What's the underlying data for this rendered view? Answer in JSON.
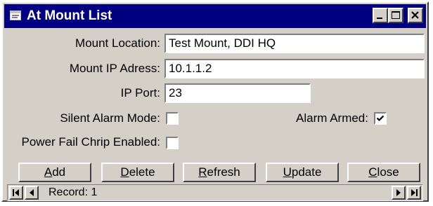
{
  "window": {
    "title": "At Mount List",
    "minimize_glyph": "_",
    "maximize_glyph": "□",
    "close_glyph": "×"
  },
  "form": {
    "mount_location": {
      "label": "Mount Location:",
      "value": "Test Mount, DDI HQ"
    },
    "mount_ip": {
      "label": "Mount IP Adress:",
      "value": "10.1.1.2"
    },
    "ip_port": {
      "label": "IP Port:",
      "value": "23"
    },
    "silent_alarm": {
      "label": "Silent Alarm Mode:",
      "checked": false
    },
    "alarm_armed": {
      "label": "Alarm Armed:",
      "checked": true
    },
    "power_fail_chirp": {
      "label": "Power Fail Chrip Enabled:",
      "checked": false
    }
  },
  "buttons": {
    "add": {
      "accel": "A",
      "rest": "dd"
    },
    "delete": {
      "accel": "D",
      "rest": "elete"
    },
    "refresh": {
      "accel": "R",
      "rest": "efresh"
    },
    "update": {
      "accel": "U",
      "rest": "pdate"
    },
    "close": {
      "accel": "C",
      "rest": "lose"
    }
  },
  "navigation": {
    "record_label": "Record: 1",
    "icons": [
      "first-record-icon",
      "previous-record-icon",
      "next-record-icon",
      "last-record-icon"
    ]
  },
  "colors": {
    "titlebar": "#000080",
    "face": "#d4d0c8"
  }
}
